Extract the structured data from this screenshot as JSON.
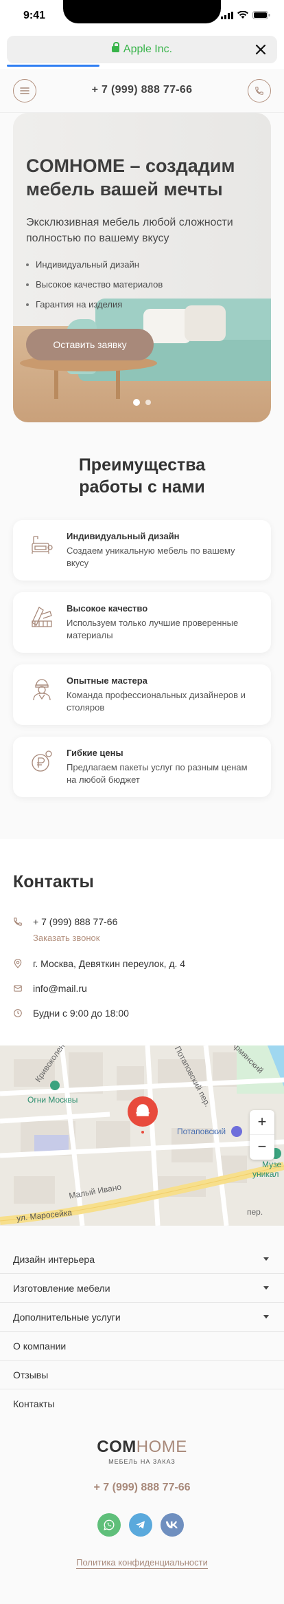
{
  "status_bar": {
    "time": "9:41"
  },
  "browser": {
    "url_title": "Apple Inc."
  },
  "header": {
    "phone": "+ 7 (999) 888 77-66"
  },
  "hero": {
    "title": "COMHOME – создадим мебель вашей мечты",
    "subtitle": "Эксклюзивная мебель любой сложности полностью по вашему вкусу",
    "bullets": [
      "Индивидуальный дизайн",
      "Высокое качество материалов",
      "Гарантия на изделия"
    ],
    "cta": "Оставить заявку"
  },
  "advantages": {
    "title_line1": "Преимущества",
    "title_line2": "работы с нами",
    "items": [
      {
        "title": "Индивидуальный дизайн",
        "text": "Создаем уникальную мебель по вашему вкусу",
        "icon": "design-icon"
      },
      {
        "title": "Высокое качество",
        "text": "Используем только лучшие проверенные материалы",
        "icon": "quality-icon"
      },
      {
        "title": "Опытные мастера",
        "text": "Команда профессиональных дизайнеров и столяров",
        "icon": "master-icon"
      },
      {
        "title": "Гибкие цены",
        "text": "Предлагаем пакеты услуг по разным ценам на любой бюджет",
        "icon": "ruble-icon"
      }
    ]
  },
  "contacts": {
    "title": "Контакты",
    "phone": "+ 7 (999) 888 77-66",
    "callback": "Заказать звонок",
    "address": "г. Москва, Девяткин переулок, д. 4",
    "email": "info@mail.ru",
    "hours": "Будни с 9:00 до 18:00"
  },
  "map": {
    "labels": [
      "Огни Москвы",
      "Потаповский",
      "Музе",
      "уникал",
      "ул. Маросейка",
      "Кривоколен",
      "Потаповский пер.",
      "Армянский",
      "Малый Ивано",
      "пер."
    ],
    "zoom_in": "+",
    "zoom_out": "−"
  },
  "footer_nav": [
    {
      "label": "Дизайн интерьера",
      "has_dropdown": true
    },
    {
      "label": "Изготовление мебели",
      "has_dropdown": true
    },
    {
      "label": "Дополнительные услуги",
      "has_dropdown": true
    },
    {
      "label": "О компании",
      "has_dropdown": false
    },
    {
      "label": "Отзывы",
      "has_dropdown": false
    },
    {
      "label": "Контакты",
      "has_dropdown": false
    }
  ],
  "footer": {
    "logo_com": "COM",
    "logo_home": "HOME",
    "logo_sub": "МЕБЕЛЬ НА ЗАКАЗ",
    "phone": "+ 7 (999) 888 77-66",
    "privacy": "Политика конфиденциальности"
  },
  "colors": {
    "accent": "#a8897a",
    "whatsapp": "#5fbf7a",
    "telegram": "#5aa9dc",
    "vk": "#6f8fbf",
    "url_green": "#38b44a"
  }
}
